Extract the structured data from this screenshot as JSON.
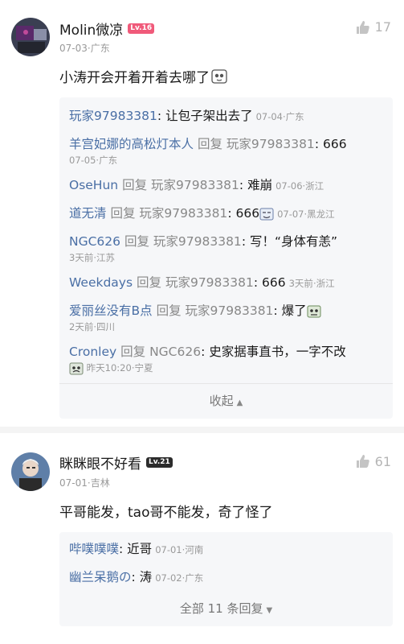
{
  "comments": [
    {
      "username": "Molin微凉",
      "level": "Lv.16",
      "level_color": "#f05a7a",
      "date": "07-03",
      "location": "广东",
      "likes": "17",
      "text": "小涛开会开着开着去哪了",
      "replies": [
        {
          "from": "玩家97983381",
          "to": "",
          "text": "让包子架出去了",
          "date": "07-04",
          "location": "广东",
          "meta_newline": false
        },
        {
          "from": "羊宫妃娜的高松灯本人",
          "to": "玩家97983381",
          "text": "666",
          "date": "07-05",
          "location": "广东",
          "meta_newline": true
        },
        {
          "from": "OseHun",
          "to": "玩家97983381",
          "text": "难崩",
          "date": "07-06",
          "location": "浙江",
          "meta_newline": false
        },
        {
          "from": "道无清",
          "to": "玩家97983381",
          "text": "666",
          "date": "07-07",
          "location": "黑龙江",
          "meta_newline": false
        },
        {
          "from": "NGC626",
          "to": "玩家97983381",
          "text": "写！“身体有恙”",
          "date": "3天前",
          "location": "江苏",
          "meta_newline": true
        },
        {
          "from": "Weekdays",
          "to": "玩家97983381",
          "text": "666",
          "date": "3天前",
          "location": "浙江",
          "meta_newline": false
        },
        {
          "from": "爱丽丝没有B点",
          "to": "玩家97983381",
          "text": "爆了",
          "date": "2天前",
          "location": "四川",
          "meta_newline": true
        },
        {
          "from": "Cronley",
          "to": "NGC626",
          "text": "史家据事直书，一字不改",
          "date": "昨天10:20",
          "location": "宁夏",
          "meta_newline": true
        }
      ],
      "reply_word": "回复",
      "collapse_label": "收起"
    },
    {
      "username": "眯眯眼不好看",
      "level": "Lv.21",
      "level_color": "#2c2c2c",
      "date": "07-01",
      "location": "吉林",
      "likes": "61",
      "text": "平哥能发，tao哥不能发，奇了怪了",
      "replies": [
        {
          "from": "哔噗噗噗",
          "to": "",
          "text": "近哥",
          "date": "07-01",
          "location": "河南",
          "meta_newline": false
        },
        {
          "from": "幽兰呆鹅の",
          "to": "",
          "text": "涛",
          "date": "07-02",
          "location": "广东",
          "meta_newline": false
        }
      ],
      "all_replies_label": "全部 11 条回复"
    }
  ]
}
